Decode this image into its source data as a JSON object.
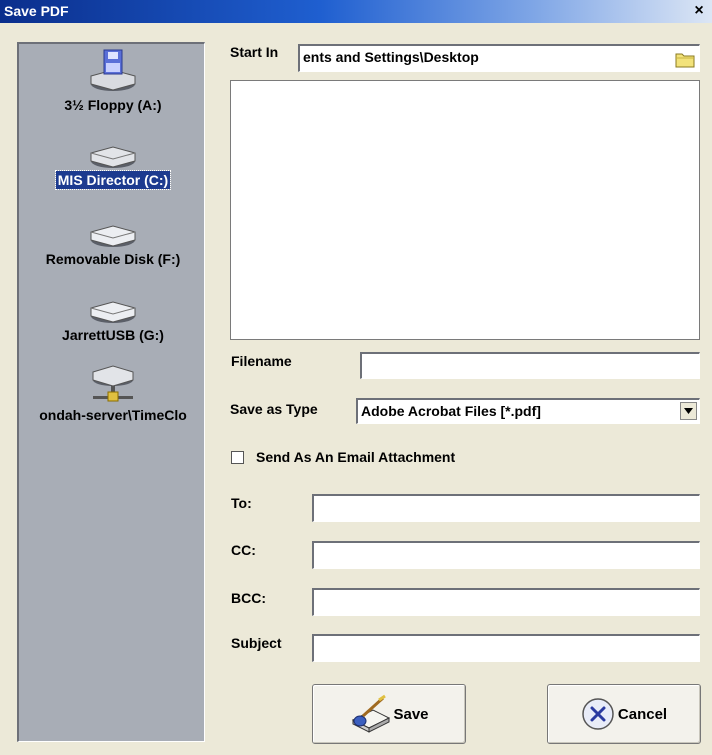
{
  "window": {
    "title": "Save PDF",
    "close_glyph": "×"
  },
  "drives": [
    {
      "label": "3½ Floppy (A:)",
      "icon": "floppy-drive-icon"
    },
    {
      "label": "MIS Director (C:)",
      "icon": "hard-drive-icon",
      "selected": true
    },
    {
      "label": "Removable Disk (F:)",
      "icon": "removable-disk-icon"
    },
    {
      "label": "JarrettUSB (G:)",
      "icon": "usb-drive-icon"
    },
    {
      "label": "ondah-server\\TimeClo",
      "icon": "network-drive-icon"
    }
  ],
  "start_in": {
    "label": "Start In",
    "value": "ents and Settings\\Desktop"
  },
  "filename": {
    "label": "Filename",
    "value": ""
  },
  "save_as_type": {
    "label": "Save as Type",
    "value": "Adobe Acrobat Files  [*.pdf]"
  },
  "email": {
    "checkbox_label": "Send As An Email Attachment",
    "checked": false
  },
  "to": {
    "label": "To:",
    "value": ""
  },
  "cc": {
    "label": "CC:",
    "value": ""
  },
  "bcc": {
    "label": "BCC:",
    "value": ""
  },
  "subject": {
    "label": "Subject",
    "value": ""
  },
  "buttons": {
    "save": "Save",
    "cancel": "Cancel"
  },
  "colors": {
    "selection": "#1c3a8f",
    "panel": "#a8adb6",
    "dialog": "#ece9d8"
  }
}
